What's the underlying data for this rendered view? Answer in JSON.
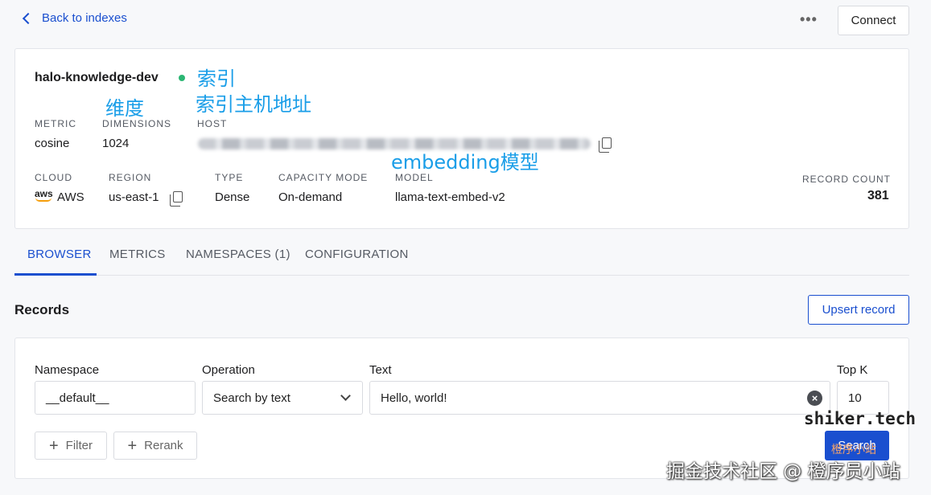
{
  "topbar": {
    "back_label": "Back to indexes",
    "more_label": "•••",
    "connect_label": "Connect"
  },
  "index": {
    "name": "halo-knowledge-dev",
    "status_color": "#2bb673",
    "metric_label": "METRIC",
    "metric": "cosine",
    "dimensions_label": "DIMENSIONS",
    "dimensions": "1024",
    "host_label": "HOST",
    "cloud_label": "CLOUD",
    "cloud": "AWS",
    "cloud_logo_text": "aws",
    "region_label": "REGION",
    "region": "us-east-1",
    "type_label": "TYPE",
    "type": "Dense",
    "capacity_label": "CAPACITY MODE",
    "capacity": "On-demand",
    "model_label": "MODEL",
    "model": "llama-text-embed-v2",
    "record_count_label": "RECORD COUNT",
    "record_count": "381"
  },
  "annotations": {
    "index": "索引",
    "dimensions": "维度",
    "host": "索引主机地址",
    "model": "embedding模型"
  },
  "tabs": [
    {
      "label": "BROWSER",
      "active": true
    },
    {
      "label": "METRICS",
      "active": false
    },
    {
      "label": "NAMESPACES (1)",
      "active": false
    },
    {
      "label": "CONFIGURATION",
      "active": false
    }
  ],
  "records": {
    "title": "Records",
    "upsert_label": "Upsert record",
    "namespace_label": "Namespace",
    "namespace_value": "__default__",
    "operation_label": "Operation",
    "operation_value": "Search by text",
    "text_label": "Text",
    "text_value": "Hello, world!",
    "topk_label": "Top K",
    "topk_value": "10",
    "filter_label": "Filter",
    "rerank_label": "Rerank",
    "search_label": "Search"
  },
  "watermarks": {
    "site": "shiker.tech",
    "small": "橙序小站",
    "footer": "掘金技术社区 @ 橙序员小站"
  },
  "colors": {
    "accent": "#1a4fcf",
    "annotation": "#1a9ee8",
    "status_dot": "#2bb673"
  }
}
